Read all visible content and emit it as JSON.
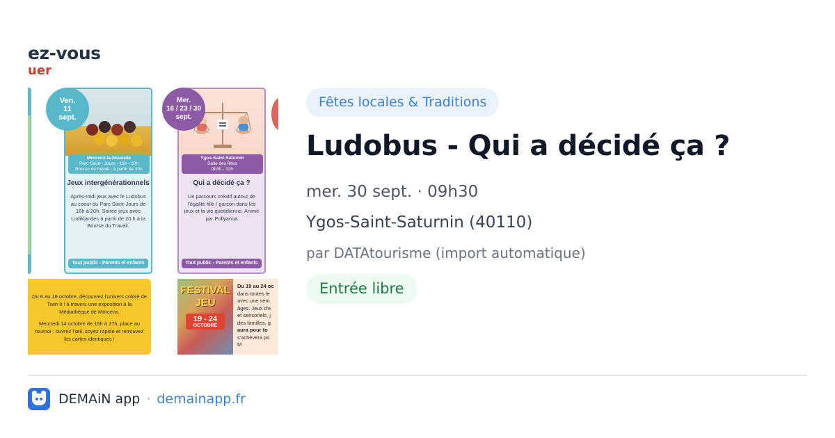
{
  "poster": {
    "heading_line1": "ez-vous",
    "heading_line2": "uer",
    "card_left": {
      "date": [
        "Ven.",
        "11",
        "sept."
      ],
      "place_lines": [
        "Morcenx-la-Nouvelle",
        "Parc Saint - Jours - 16h - 20h",
        "Bourse du travail - à partir de 20h"
      ],
      "title": "Jeux intergénérationnels",
      "body": "Après-midi jeux avec le Ludobus au coeur du Parc Saint-Jours de 16h à 20h. Soirée jeux avec Ludiklandes à partir de 20 h à la Bourse du Travail.",
      "footer": "Tout public - Parents et enfants"
    },
    "card_right": {
      "date": [
        "Mer.",
        "16 / 23 / 30",
        "sept."
      ],
      "place_lines": [
        "Ygos-Saint-Saturnin",
        "Salle des fêtes",
        "9h30 - 12h"
      ],
      "title": "Qui a décidé ça ?",
      "body": "Un parcours créatif autour de l'égalité fille / garçon dans les jeux et la vie quotidienne. Animé par Pollyanna",
      "footer": "Tout public - Parents et enfants"
    },
    "yellow_box": {
      "p1": "Du 6 au 16 octobre, découvrez l'univers coloré de Twin It ! à travers une exposition à la Médiathèque de Morcenx.",
      "p2": "Mercredi 14 octobre de 15h à 17h, place au tournoi : ouvrez l'œil, soyez rapide et retrouvez les cartes identiques !"
    },
    "festival": {
      "word": "FESTIVAL JEU",
      "dates": "19 - 24",
      "month": "OCTOBRE"
    },
    "peach_box_lines": [
      "Du 19 au 24 oc",
      "dans toutes le",
      "avec une sem",
      "âges. Jeux d'e",
      "et sensoriels, j",
      "des familles, g",
      "aura pour to",
      "s'achèvera po",
      "M"
    ]
  },
  "event": {
    "category": "Fêtes locales & Traditions",
    "title": "Ludobus - Qui a décidé ça ?",
    "datetime": "mer. 30 sept. · 09h30",
    "location": "Ygos-Saint-Saturnin (40110)",
    "author": "par DATAtourisme (import automatique)",
    "price": "Entrée libre"
  },
  "footer": {
    "app_name": "DEMAiN app",
    "separator": "·",
    "link": "demainapp.fr",
    "app_icon": "cat-face-icon"
  },
  "colors": {
    "category_bg": "#eaf2fc",
    "category_text": "#3b82d6",
    "price_bg": "#ecfaf0",
    "price_text": "#1c7a43",
    "brand_blue": "#2f6fe0",
    "poster_teal": "#58b7c9",
    "poster_purple": "#8d5aa6",
    "poster_yellow": "#f6c72b"
  }
}
